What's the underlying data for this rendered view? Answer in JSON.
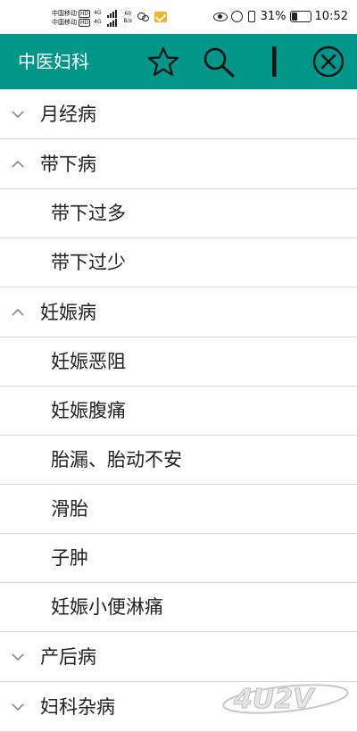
{
  "status_bar": {
    "carrier1": "中国移动",
    "carrier2": "中国移动",
    "hd": "HD",
    "net1": "4G",
    "net2": "4G",
    "speed_value": "60",
    "speed_unit": "B/s",
    "battery_percent": "31%",
    "battery_level": 0.31,
    "time": "10:52"
  },
  "app_bar": {
    "title": "中医妇科",
    "background": "#009688",
    "actions": [
      "star-icon",
      "search-icon",
      "cursor-bar-icon",
      "close-circle-icon"
    ]
  },
  "list": {
    "groups": [
      {
        "label": "月经病",
        "expanded": false,
        "children": []
      },
      {
        "label": "带下病",
        "expanded": true,
        "children": [
          "带下过多",
          "带下过少"
        ]
      },
      {
        "label": "妊娠病",
        "expanded": true,
        "children": [
          "妊娠恶阻",
          "妊娠腹痛",
          "胎漏、胎动不安",
          "滑胎",
          "子肿",
          "妊娠小便淋痛"
        ]
      },
      {
        "label": "产后病",
        "expanded": false,
        "children": []
      },
      {
        "label": "妇科杂病",
        "expanded": false,
        "children": []
      }
    ]
  },
  "watermark": {
    "text": "4U2V",
    "logo": "watermark-logo"
  }
}
